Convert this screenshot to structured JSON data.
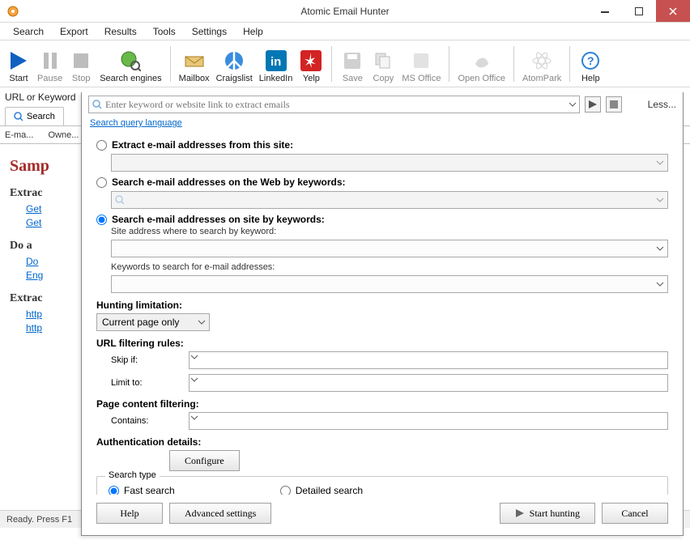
{
  "window": {
    "title": "Atomic Email Hunter"
  },
  "menu": {
    "search": "Search",
    "export": "Export",
    "results": "Results",
    "tools": "Tools",
    "settings": "Settings",
    "help": "Help"
  },
  "toolbar": {
    "start": "Start",
    "pause": "Pause",
    "stop": "Stop",
    "engines": "Search engines",
    "mailbox": "Mailbox",
    "craigslist": "Craigslist",
    "linkedin": "LinkedIn",
    "yelp": "Yelp",
    "save": "Save",
    "copy": "Copy",
    "msoffice": "MS Office",
    "openoffice": "Open Office",
    "atompark": "AtomPark",
    "help": "Help"
  },
  "searchbar": {
    "label": "URL or Keyword",
    "placeholder": "Enter keyword or website link to extract emails",
    "less": "Less...",
    "query_link": "Search query language"
  },
  "tabs": {
    "search": "Search"
  },
  "columns": {
    "email": "E-ma...",
    "owner": "Owne..."
  },
  "bg": {
    "sample": "Samp",
    "extract1": "Extrac",
    "get1": "Get",
    "get2": "Get",
    "doa": "Do a",
    "do1": "Do",
    "eng": "Eng",
    "extract2": "Extrac",
    "http1": "http",
    "http2": "http"
  },
  "status": {
    "text": "Ready. Press F1"
  },
  "dialog": {
    "r1": "Extract e-mail addresses from this site:",
    "r2": "Search e-mail addresses on the Web by keywords:",
    "r3": "Search e-mail addresses on site by keywords:",
    "r3_sub1": "Site address where to search by keyword:",
    "r3_sub2": "Keywords to search for e-mail addresses:",
    "hunting": "Hunting limitation:",
    "hunting_val": "Current page only",
    "url_filter": "URL filtering rules:",
    "skip": "Skip if:",
    "limit": "Limit to:",
    "pagefilter": "Page content filtering:",
    "contains": "Contains:",
    "auth": "Authentication details:",
    "configure": "Configure",
    "searchtype": "Search type",
    "fast": "Fast search",
    "detailed": "Detailed search",
    "help": "Help",
    "advanced": "Advanced settings",
    "start": "Start hunting",
    "cancel": "Cancel"
  }
}
